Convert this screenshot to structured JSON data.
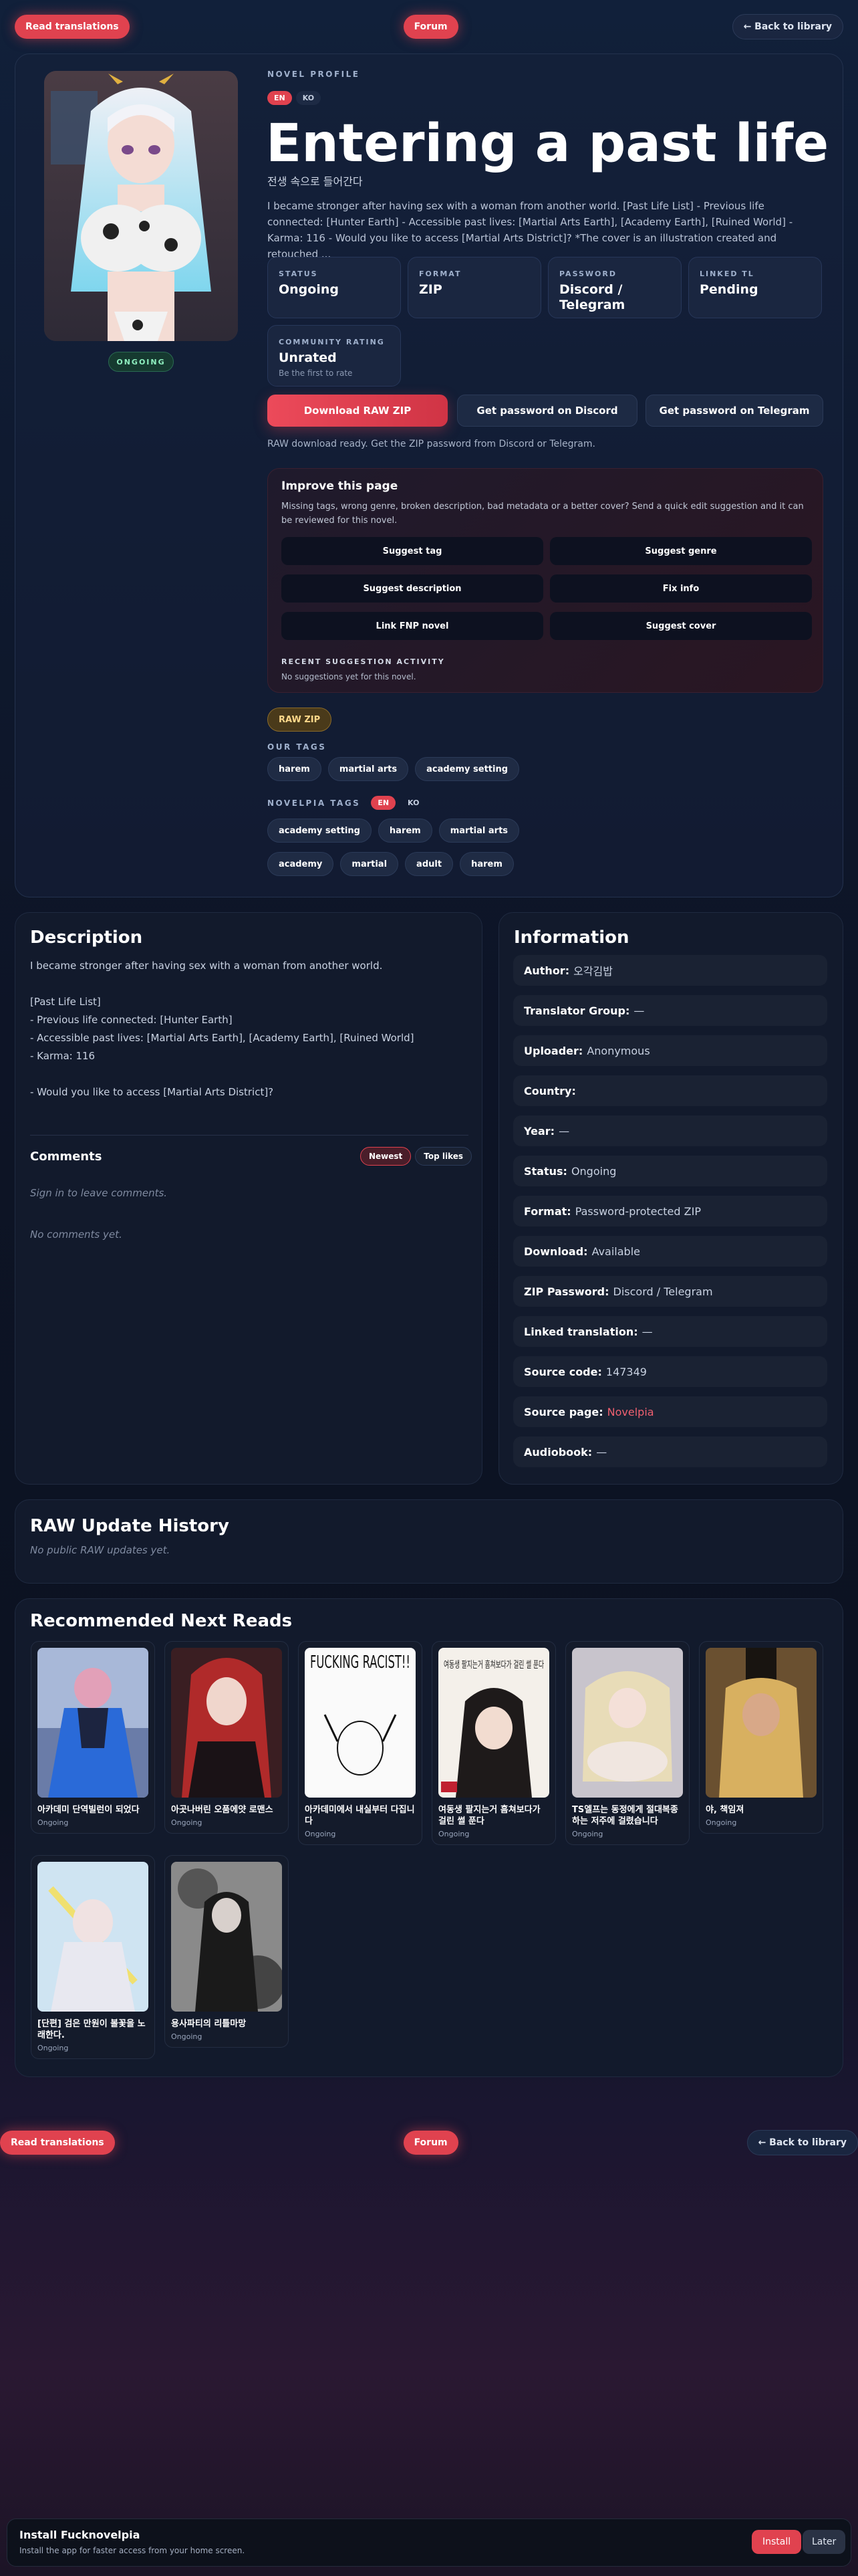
{
  "nav": {
    "read_translations": "Read translations",
    "forum": "Forum",
    "back_to_library": "← Back to library"
  },
  "novel": {
    "eyebrow": "NOVEL PROFILE",
    "lang_en": "EN",
    "lang_ko": "KO",
    "title": "Entering a past life",
    "korean_title": "전생 속으로 들어간다",
    "summary": "I became stronger after having sex with a woman from another world. [Past Life List] - Previous life connected: [Hunter Earth] - Accessible past lives: [Martial Arts Earth], [Academy Earth], [Ruined World] - Karma: 116 - Would you like to access [Martial Arts District]? *The cover is an illustration created and retouched ...",
    "status_chip": "ONGOING"
  },
  "stats": [
    {
      "label": "STATUS",
      "value": "Ongoing"
    },
    {
      "label": "FORMAT",
      "value": "ZIP"
    },
    {
      "label": "PASSWORD",
      "value": "Discord / Telegram"
    },
    {
      "label": "LINKED TL",
      "value": "Pending"
    },
    {
      "label": "COMMUNITY RATING",
      "value": "Unrated",
      "sub": "Be the first to rate"
    }
  ],
  "actions": {
    "download": "Download RAW ZIP",
    "discord": "Get password on Discord",
    "telegram": "Get password on Telegram",
    "note": "RAW download ready. Get the ZIP password from Discord or Telegram."
  },
  "improve": {
    "title": "Improve this page",
    "desc": "Missing tags, wrong genre, broken description, bad metadata or a better cover? Send a quick edit suggestion and it can be reviewed for this novel.",
    "buttons": [
      "Suggest tag",
      "Suggest genre",
      "Suggest description",
      "Fix info",
      "Link FNP novel",
      "Suggest cover"
    ],
    "activity_label": "RECENT SUGGESTION ACTIVITY",
    "activity_text": "No suggestions yet for this novel."
  },
  "tags": {
    "raw_zip": "RAW ZIP",
    "our_label": "OUR TAGS",
    "our": [
      "harem",
      "martial arts",
      "academy setting"
    ],
    "novelpia_label": "NOVELPIA TAGS",
    "novelpia_en": "EN",
    "novelpia_ko": "KO",
    "novelpia": [
      "academy setting",
      "harem",
      "martial arts",
      "academy",
      "martial",
      "adult",
      "harem"
    ]
  },
  "description": {
    "heading": "Description",
    "lines": [
      "I became stronger after having sex with a woman from another world.",
      "",
      "[Past Life List]",
      "- Previous life connected: [Hunter Earth]",
      "- Accessible past lives: [Martial Arts Earth], [Academy Earth], [Ruined World]",
      "- Karma: 116",
      "",
      "- Would you like to access [Martial Arts District]?"
    ]
  },
  "comments": {
    "heading": "Comments",
    "newest": "Newest",
    "top_likes": "Top likes",
    "sign_in": "Sign in to leave comments.",
    "empty": "No comments yet."
  },
  "information": {
    "heading": "Information",
    "rows": [
      {
        "label": "Author:",
        "value": "오각김밥"
      },
      {
        "label": "Translator Group:",
        "value": "—"
      },
      {
        "label": "Uploader:",
        "value": "Anonymous"
      },
      {
        "label": "Country:",
        "value": ""
      },
      {
        "label": "Year:",
        "value": "—"
      },
      {
        "label": "Status:",
        "value": "Ongoing"
      },
      {
        "label": "Format:",
        "value": "Password-protected ZIP"
      },
      {
        "label": "Download:",
        "value": "Available"
      },
      {
        "label": "ZIP Password:",
        "value": "Discord / Telegram"
      },
      {
        "label": "Linked translation:",
        "value": "—"
      },
      {
        "label": "Source code:",
        "value": "147349"
      },
      {
        "label": "Source page:",
        "value": "Novelpia",
        "link": true
      },
      {
        "label": "Audiobook:",
        "value": "—"
      }
    ]
  },
  "raw_history": {
    "heading": "RAW Update History",
    "empty": "No public RAW updates yet."
  },
  "recommended": {
    "heading": "Recommended Next Reads",
    "items": [
      {
        "title": "아카데미 단역빌런이 되었다",
        "status": "Ongoing"
      },
      {
        "title": "아곳나버린 오품에얏 로맨스",
        "status": "Ongoing"
      },
      {
        "title": "아카데미에서 내실부터 다집니다",
        "status": "Ongoing"
      },
      {
        "title": "여동생 팔지는거 흠쳐보다가 걸린 썰 푼다",
        "status": "Ongoing"
      },
      {
        "title": "TS엘프는 동정에게 절대복종하는 저주에 걸렸습니다",
        "status": "Ongoing"
      },
      {
        "title": "야, 책임져",
        "status": "Ongoing"
      },
      {
        "title": "[단편] 검은 만원이 볼꽃을 노래한다.",
        "status": "Ongoing"
      },
      {
        "title": "용사파티의 리틀마망",
        "status": "Ongoing"
      }
    ],
    "thumb3_text": "FUCKING RACIST!!",
    "thumb4_text": "여동생 팔지는거 흠쳐보다가 걸린 썰 푼다"
  },
  "install": {
    "title": "Install Fucknovelpia",
    "desc": "Install the app for faster access from your home screen.",
    "install": "Install",
    "later": "Later"
  }
}
